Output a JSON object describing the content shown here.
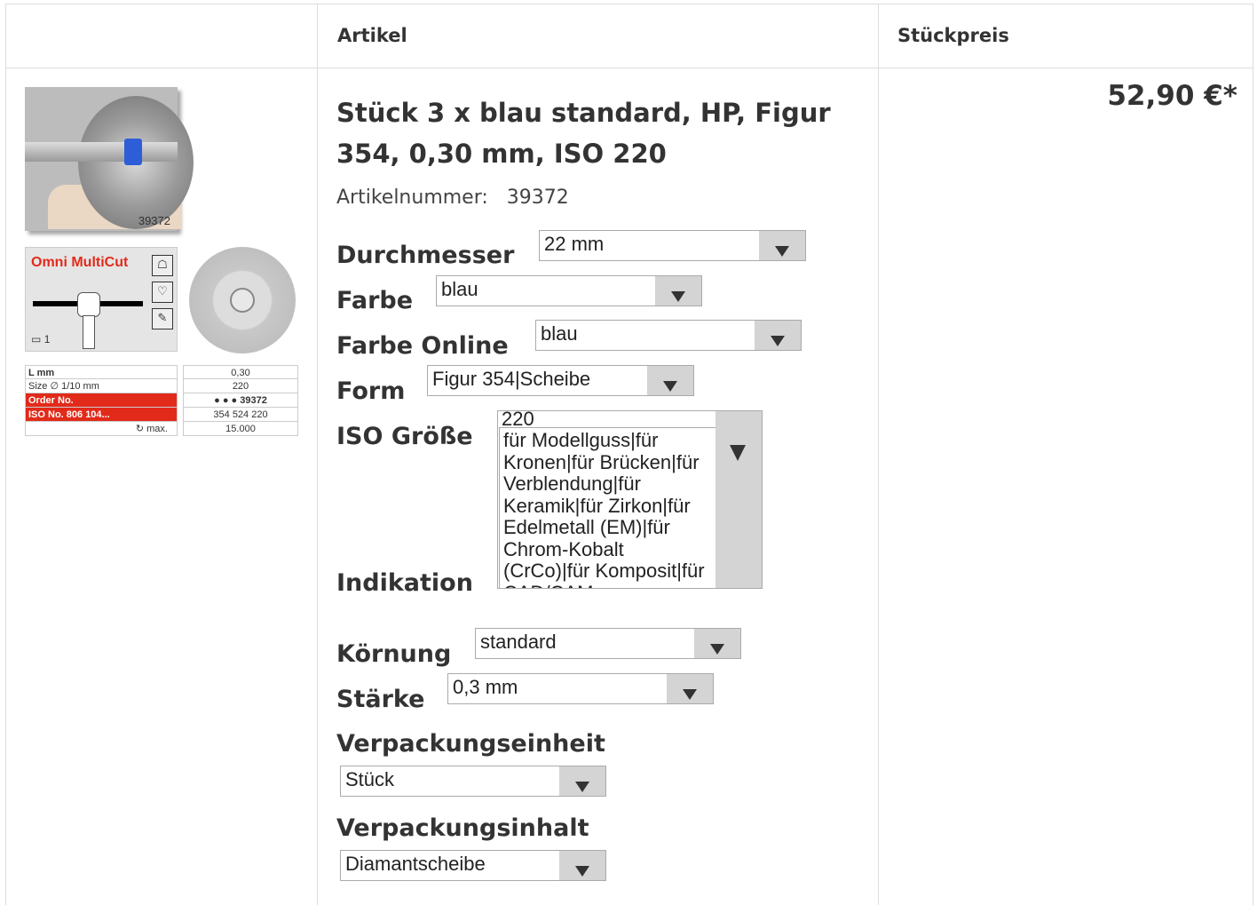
{
  "table_header": {
    "col_article": "Artikel",
    "col_price": "Stückpreis"
  },
  "images": {
    "photo_number": "39372",
    "card_title": "Omni MultiCut",
    "card_pack_count": "1",
    "spec_left": [
      "L mm",
      "Size ∅ 1/10 mm",
      "Order No.",
      "ISO No. 806 104...",
      "↻ max."
    ],
    "spec_right": [
      "0,30",
      "220",
      "● ● ● 39372",
      "354 524 220",
      "15.000"
    ]
  },
  "product": {
    "title": "Stück 3 x blau standard, HP, Figur 354, 0,30 mm, ISO 220",
    "article_label": "Artikelnummer:",
    "article_number": "39372",
    "price": "52,90 €*"
  },
  "options": {
    "durchmesser": {
      "label": "Durchmesser",
      "value": "22 mm"
    },
    "farbe": {
      "label": "Farbe",
      "value": "blau"
    },
    "farbe_online": {
      "label": "Farbe Online",
      "value": "blau"
    },
    "form": {
      "label": "Form",
      "value": "Figur 354|Scheibe"
    },
    "iso": {
      "label": "ISO Größe",
      "value": "220"
    },
    "indikation": {
      "label": "Indikation",
      "value": "für Modellguss|für Kronen|für Brücken|für Verblendung|für Keramik|für Zirkon|für Edelmetall (EM)|für Chrom-Kobalt (CrCo)|für Komposit|für CAD/CAM"
    },
    "koernung": {
      "label": "Körnung",
      "value": "standard"
    },
    "staerke": {
      "label": "Stärke",
      "value": "0,3 mm"
    },
    "verpackungseinheit": {
      "label": "Verpackungseinheit",
      "value": "Stück"
    },
    "verpackungsinhalt": {
      "label": "Verpackungsinhalt",
      "value": "Diamantscheibe"
    }
  }
}
